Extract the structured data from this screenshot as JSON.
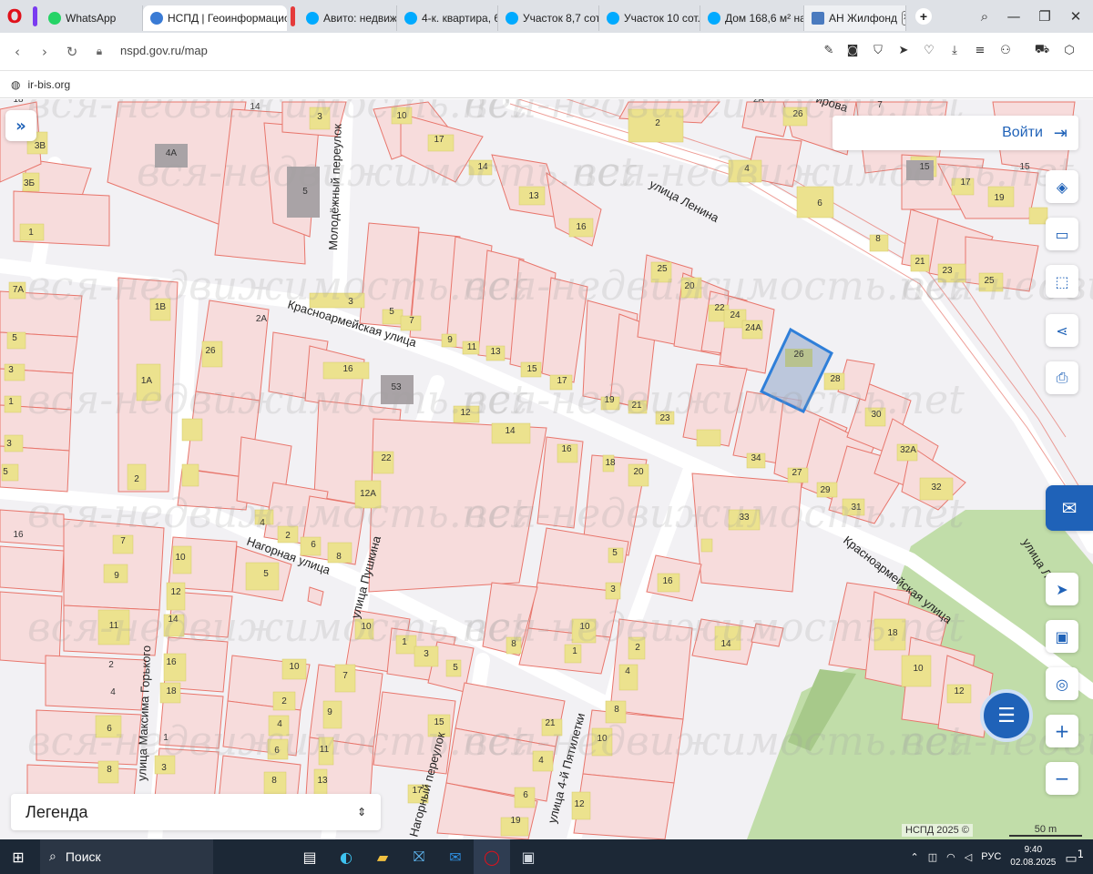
{
  "browser": {
    "tabs": [
      {
        "label": "WhatsApp",
        "icon": "whatsapp-icon",
        "color": "#25d366"
      },
      {
        "label": "НСПД | Геоинформацион",
        "icon": "nspd-icon",
        "color": "#3a7bd5",
        "active": true
      },
      {
        "label": "Авито: недвижи",
        "icon": "avito-icon",
        "color": "#00aaff"
      },
      {
        "label": "4-к. квартира, 6",
        "icon": "avito-icon",
        "color": "#00aaff"
      },
      {
        "label": "Участок 8,7 сот.",
        "icon": "avito-icon",
        "color": "#00aaff"
      },
      {
        "label": "Участок 10 сот.",
        "icon": "avito-icon",
        "color": "#00aaff"
      },
      {
        "label": "Дом 168,6 м² на",
        "icon": "avito-icon",
        "color": "#00aaff"
      },
      {
        "label": "АН Жилфонд",
        "icon": "building-icon",
        "color": "#4b7bbf"
      }
    ],
    "url": "nspd.gov.ru/map",
    "bookmark": "ir-bis.org"
  },
  "map": {
    "login_label": "Войти",
    "legend_label": "Легенда",
    "copyright": "НСПД 2025 ©",
    "scale_label": "50 m",
    "watermark": "вся-недвижимость.net",
    "streets": [
      "улица Ленина",
      "Красноармейская улица",
      "Молодёжный переулок",
      "Нагорная улица",
      "улица Пушкина",
      "улица Максима Горького",
      "Нагорный переулок",
      "улица 4-й Пятилетки",
      "Красноармейская улица",
      "улица Ле"
    ],
    "street_fragment_top": "ирова",
    "lot_numbers": [
      "3",
      "10",
      "17",
      "14",
      "13",
      "16",
      "18",
      "15",
      "17",
      "19",
      "2A",
      "26",
      "7",
      "2",
      "4",
      "6",
      "8",
      "21",
      "23",
      "25",
      "15",
      "3В",
      "3Б",
      "4A",
      "5",
      "1",
      "3",
      "5",
      "7",
      "9",
      "11",
      "13",
      "15",
      "17",
      "19",
      "21",
      "23",
      "25",
      "20",
      "22",
      "24",
      "24A",
      "26",
      "28",
      "30",
      "32A",
      "32",
      "34",
      "27",
      "29",
      "31",
      "33",
      "1B",
      "26",
      "1A",
      "2",
      "2A",
      "16",
      "53",
      "12",
      "14",
      "16",
      "18",
      "20",
      "22",
      "12A",
      "7A",
      "5",
      "3",
      "1",
      "3",
      "5",
      "7",
      "9",
      "11",
      "2",
      "4",
      "6",
      "8",
      "10",
      "12",
      "14",
      "16",
      "18",
      "1",
      "3",
      "5",
      "4",
      "2",
      "6",
      "8",
      "10",
      "2",
      "4",
      "6",
      "8",
      "10",
      "1",
      "3",
      "5",
      "7",
      "9",
      "11",
      "13",
      "15",
      "17",
      "19",
      "21",
      "4",
      "6",
      "8",
      "10",
      "1",
      "3",
      "5",
      "2",
      "4",
      "8",
      "10",
      "12",
      "14",
      "16",
      "18",
      "10",
      "12",
      "14",
      "16",
      "1A",
      "1",
      "3",
      "5",
      "7",
      "9",
      "11",
      "16",
      "2",
      "4",
      "6",
      "8",
      "24",
      "26",
      "28"
    ],
    "highlight_parcel": "28",
    "colors": {
      "parcel_fill": "#f7dcdc",
      "parcel_stroke": "#e8766c",
      "building": "#ece28e",
      "highlight": "#2f7fd9",
      "park": "#b9d99b",
      "accent": "#1f62b8"
    }
  },
  "taskbar": {
    "search_label": "Поиск",
    "lang": "РУС",
    "time": "9:40",
    "date": "02.08.2025",
    "notifications": "1"
  }
}
